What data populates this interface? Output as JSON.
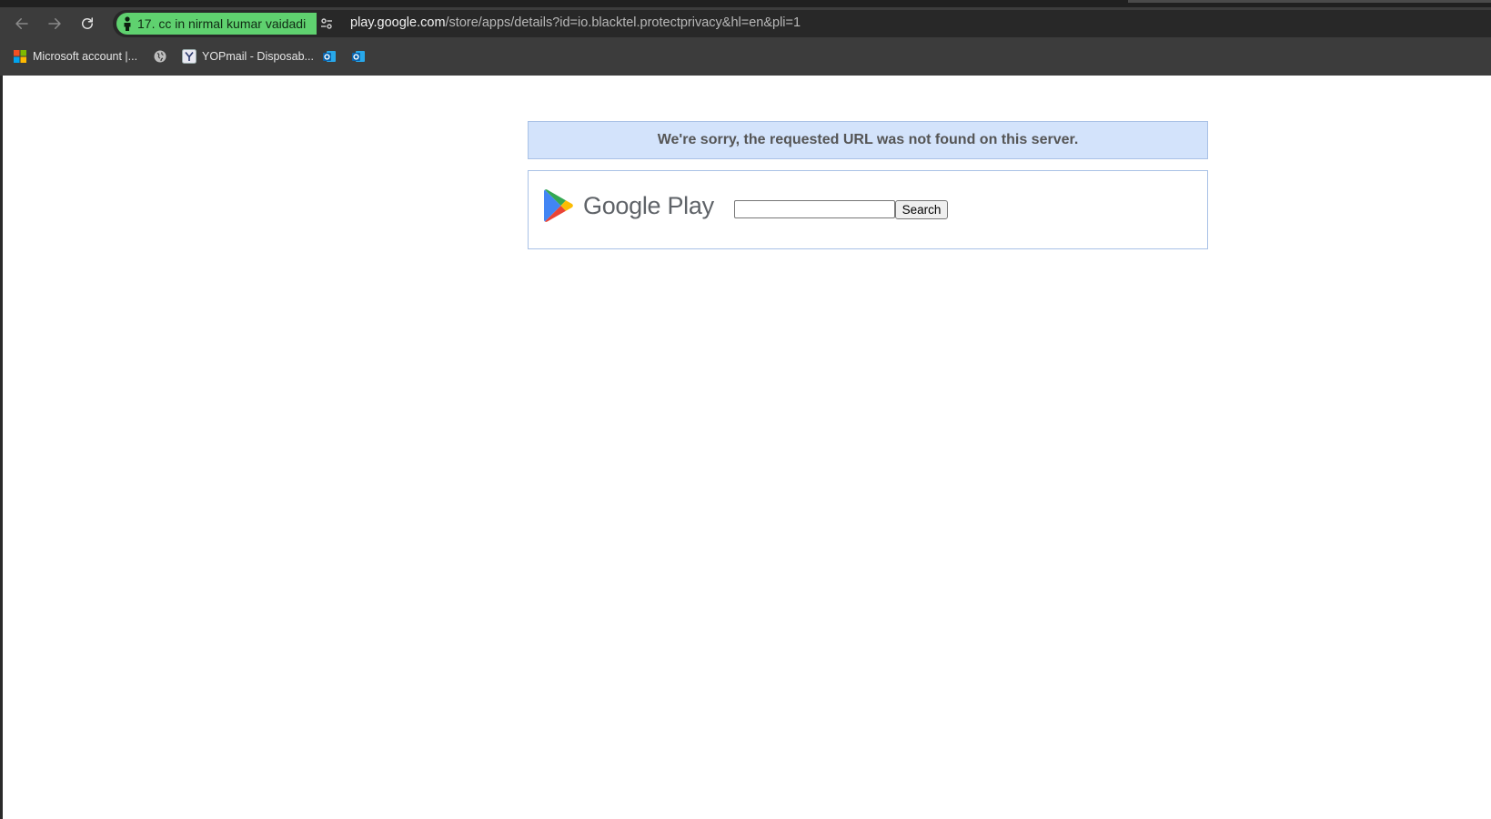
{
  "browser": {
    "profile_chip": "17. cc in nirmal kumar vaidadi",
    "url_host": "play.google.com",
    "url_path": "/store/apps/details?id=io.blacktel.protectprivacy&hl=en&pli=1",
    "profile_chip_color": "#5fd16f",
    "bookmarks": [
      {
        "label": "Microsoft account |...",
        "icon": "microsoft-logo-icon"
      },
      {
        "label": "",
        "icon": "globe-icon"
      },
      {
        "label": "YOPmail - Disposab...",
        "icon": "yopmail-icon"
      },
      {
        "label": "",
        "icon": "outlook-icon"
      },
      {
        "label": "",
        "icon": "outlook-icon"
      }
    ]
  },
  "page": {
    "error_message": "We're sorry, the requested URL was not found on this server.",
    "logo_text": "Google Play",
    "search_value": "",
    "search_button": "Search",
    "banner_color": "#d3e3fb"
  }
}
